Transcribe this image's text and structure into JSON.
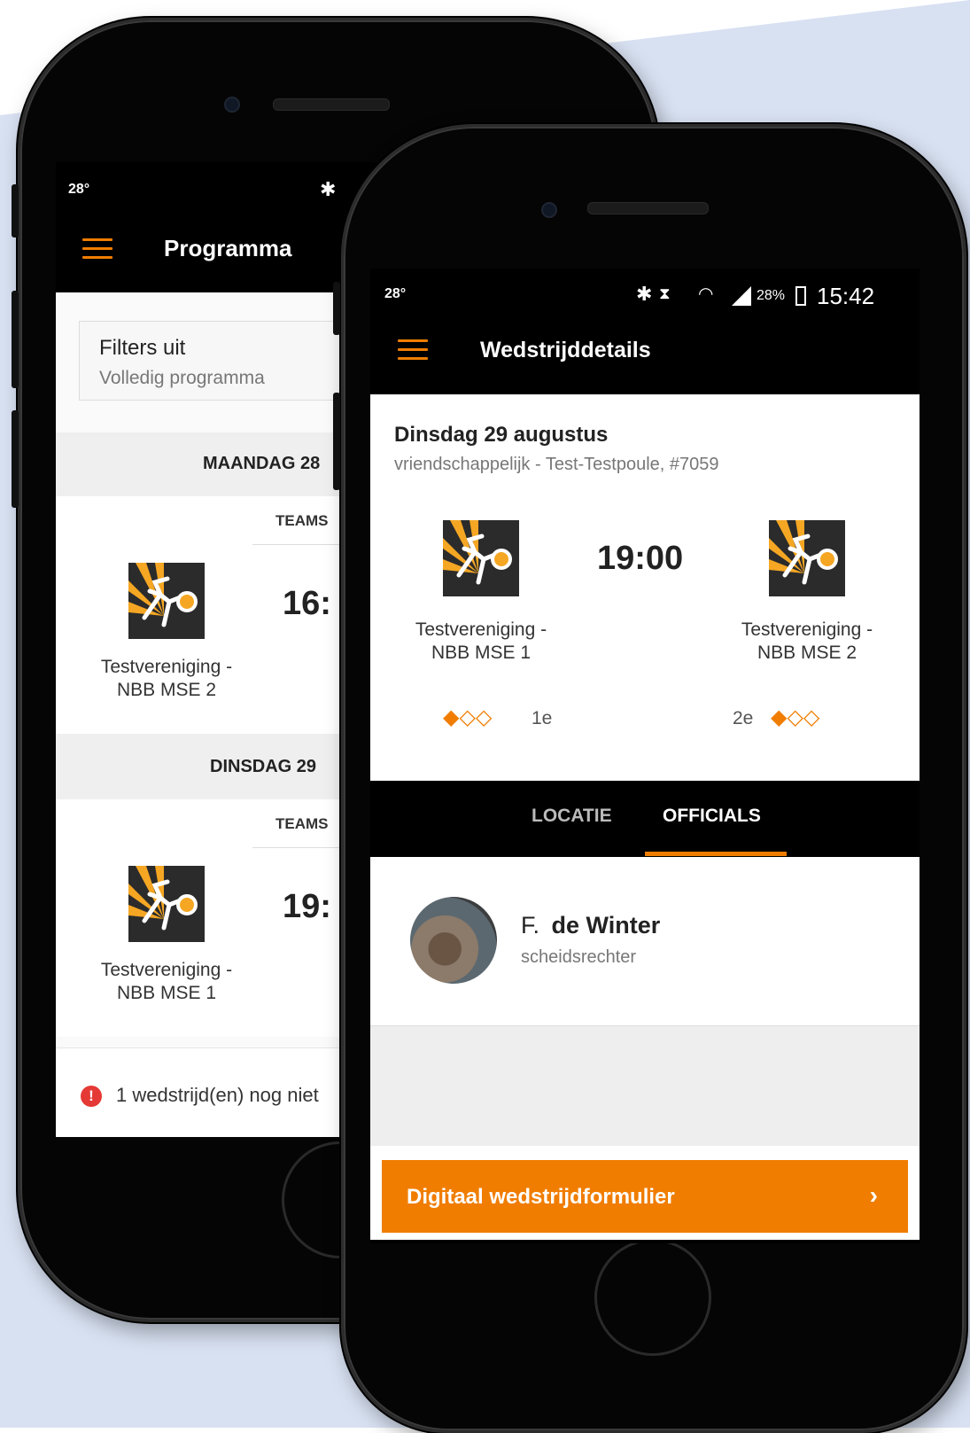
{
  "colors": {
    "accent": "#f07d00",
    "background": "#d8e1f2",
    "warning": "#e53935"
  },
  "back_phone": {
    "status": {
      "temp": "28°"
    },
    "appbar": {
      "title": "Programma"
    },
    "filter": {
      "title": "Filters uit",
      "subtitle": "Volledig programma"
    },
    "days": [
      {
        "header": "MAANDAG 28",
        "teams_label": "TEAMS",
        "time": "16:",
        "team": "Testvereniging -\nNBB MSE 2"
      },
      {
        "header": "DINSDAG 29",
        "teams_label": "TEAMS",
        "time": "19:",
        "team": "Testvereniging -\nNBB MSE 1"
      }
    ],
    "warning": "1 wedstrijd(en) nog niet"
  },
  "front_phone": {
    "status": {
      "temp": "28°",
      "battery": "28%",
      "time": "15:42"
    },
    "appbar": {
      "title": "Wedstrijddetails"
    },
    "match": {
      "date": "Dinsdag 29 augustus",
      "info": "vriendschappelijk - Test-Testpoule, #7059",
      "time": "19:00",
      "home": {
        "name": "Testvereniging -\nNBB MSE 1",
        "rank": "1e"
      },
      "away": {
        "name": "Testvereniging -\nNBB MSE 2",
        "rank": "2e"
      }
    },
    "tabs": [
      {
        "label": "LOCATIE"
      },
      {
        "label": "OFFICIALS"
      }
    ],
    "official": {
      "initial": "F.",
      "name": "de Winter",
      "role": "scheidsrechter"
    },
    "cta": {
      "label": "Digitaal wedstrijdformulier",
      "chevron": "›"
    }
  }
}
